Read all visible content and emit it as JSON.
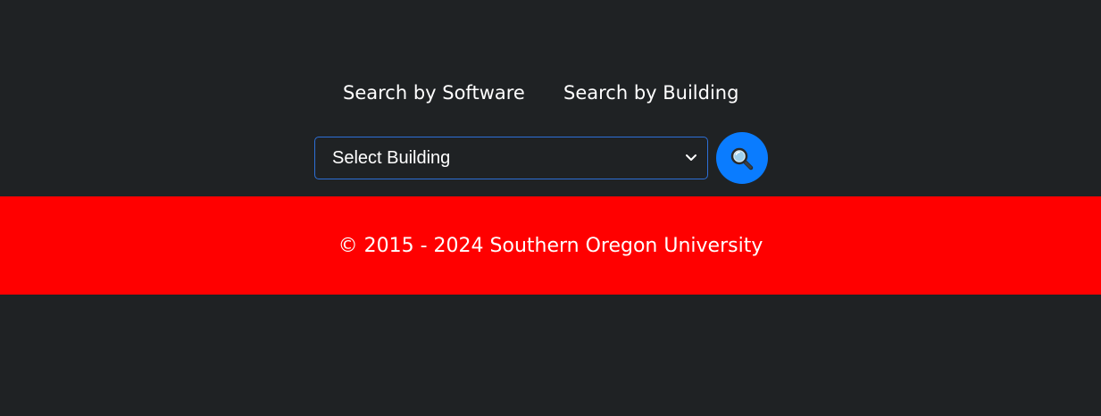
{
  "tabs": {
    "software_label": "Search by Software",
    "building_label": "Search by Building"
  },
  "search": {
    "select_value": "Select Building",
    "button_icon": "search-icon"
  },
  "footer": {
    "copyright": "© 2015 - 2024 Southern Oregon University"
  },
  "colors": {
    "background": "#1f2224",
    "footer_background": "#ff0000",
    "button_background": "#0a7cff",
    "select_border": "#2d6fd6",
    "text": "#ffffff"
  }
}
